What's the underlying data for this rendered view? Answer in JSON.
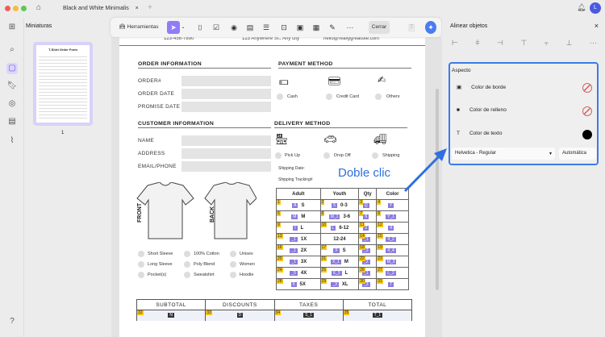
{
  "window": {
    "tab_title": "Black and White Minimalis",
    "user_initial": "L"
  },
  "sidebar": {
    "title": "Miniaturas",
    "thumb_title": "T-Shirt Order Form",
    "page_number": "1"
  },
  "toolbar": {
    "tools_label": "Herramientas",
    "close_label": "Cerrar",
    "more": "···"
  },
  "right_panel": {
    "title": "Alinear objetos",
    "section": "Aspecto",
    "border_color": "Color de borde",
    "fill_color": "Color de relleno",
    "text_color": "Color de texto",
    "font": "Helvetica - Regular",
    "size": "Automática",
    "text_color_value": "#000000",
    "accent": "#3b7be8"
  },
  "annotation": {
    "text": "Doble clic"
  },
  "doc": {
    "phone": "123-456-7890",
    "address": "123 Anywhere St., Any city",
    "email": "hello@reallygreatsite.com",
    "order_info": "ORDER INFORMATION",
    "order_fields": [
      "ORDER#",
      "ORDER DATE",
      "PROMISE DATE"
    ],
    "payment": "PAYMENT METHOD",
    "payment_options": [
      "Cash",
      "Credit Card",
      "Others"
    ],
    "customer_info": "CUSTOMER INFORMATION",
    "customer_fields": [
      "NAME",
      "ADDRESS",
      "EMAIL/PHONE"
    ],
    "delivery": "DELIVERY METHOD",
    "delivery_options": [
      "Pick Up",
      "Drop Off",
      "Shipping"
    ],
    "shipping_date": "Shipping Date:",
    "shipping_tracking": "Shipping Tracking#",
    "front": "FRONT",
    "back": "BACK",
    "options": [
      "Short Sleeve",
      "100% Cotton",
      "Unisex",
      "Long Sleeve",
      "Poly Blend",
      "Women",
      "Pocket(s)",
      "Sweatshirt",
      "Hoodie"
    ],
    "size_headers": [
      "Adult",
      "Youth",
      "Qty",
      "Color"
    ],
    "size_rows": [
      [
        [
          "1",
          "A",
          "S"
        ],
        [
          "2",
          "5",
          "0-3"
        ],
        [
          "3",
          "Q",
          ""
        ],
        [
          "4",
          "Y",
          ""
        ]
      ],
      [
        [
          "5",
          "M",
          "M"
        ],
        [
          "6",
          "M_1",
          "3-6"
        ],
        [
          "7",
          "6",
          ""
        ],
        [
          "8",
          "Y_1",
          ""
        ]
      ],
      [
        [
          "9",
          "I",
          "L"
        ],
        [
          "10",
          "L",
          "6-12"
        ],
        [
          "11",
          "2",
          ""
        ],
        [
          "12",
          "4",
          ""
        ]
      ],
      [
        [
          "13",
          "_1",
          "1X"
        ],
        [
          "",
          "",
          "12-24"
        ],
        [
          "14",
          "_1",
          ""
        ],
        [
          "15",
          "4_2",
          ""
        ]
      ],
      [
        [
          "16",
          "_1",
          "2X"
        ],
        [
          "17",
          "X",
          "S"
        ],
        [
          "18",
          "_3",
          ""
        ],
        [
          "19",
          "4_4",
          ""
        ]
      ],
      [
        [
          "20",
          "_1",
          "3X"
        ],
        [
          "21",
          "X_1",
          "M"
        ],
        [
          "22",
          "_2",
          ""
        ],
        [
          "23",
          "M_3",
          ""
        ]
      ],
      [
        [
          "24",
          "_5",
          "4X"
        ],
        [
          "25",
          "X_2",
          "L"
        ],
        [
          "26",
          "_1",
          ""
        ],
        [
          "27",
          "L_2",
          ""
        ]
      ],
      [
        [
          "28",
          "5",
          "5X"
        ],
        [
          "29",
          "_3",
          "XL"
        ],
        [
          "30",
          "_3",
          ""
        ],
        [
          "31",
          "T",
          ""
        ]
      ]
    ],
    "totals": [
      {
        "label": "SUBTOTAL",
        "num": "32",
        "tag": "N"
      },
      {
        "label": "DISCOUNTS",
        "num": "33",
        "tag": "D"
      },
      {
        "label": "TAXES",
        "num": "34",
        "tag": "S_1"
      },
      {
        "label": "TOTAL",
        "num": "35",
        "tag": "T_1"
      }
    ]
  }
}
